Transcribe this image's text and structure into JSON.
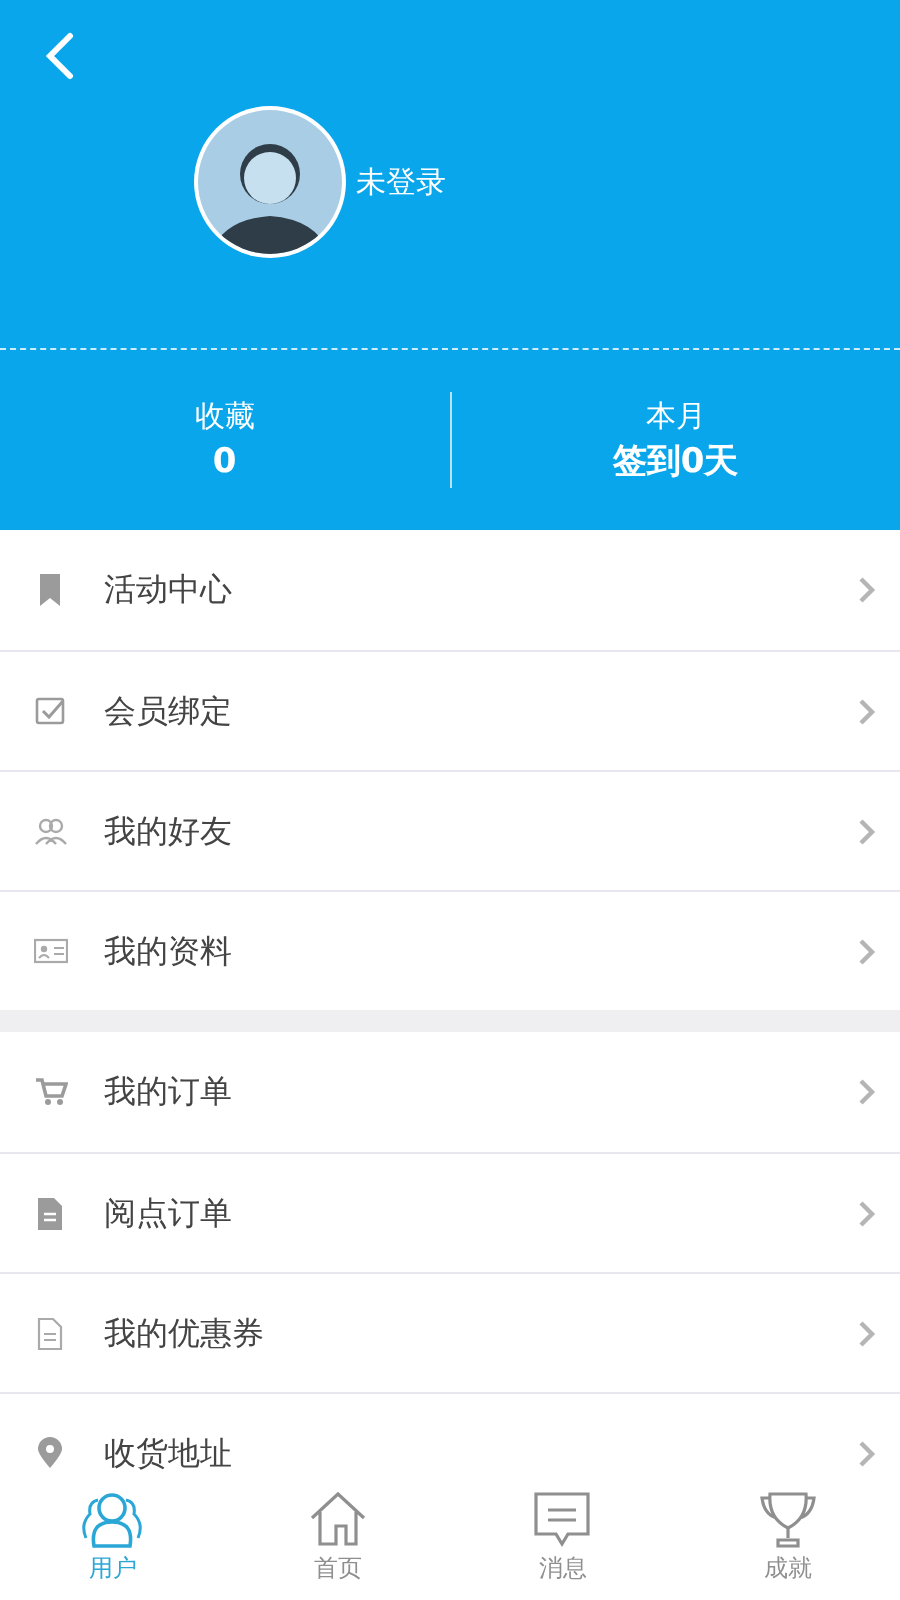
{
  "header": {
    "username": "未登录"
  },
  "stats": [
    {
      "label": "收藏",
      "value": "0"
    },
    {
      "label": "本月",
      "value": "签到0天"
    }
  ],
  "menu_groups": [
    {
      "items": [
        {
          "label": "活动中心"
        },
        {
          "label": "会员绑定"
        },
        {
          "label": "我的好友"
        },
        {
          "label": "我的资料"
        }
      ]
    },
    {
      "items": [
        {
          "label": "我的订单"
        },
        {
          "label": "阅点订单"
        },
        {
          "label": "我的优惠券"
        },
        {
          "label": "收货地址"
        }
      ]
    }
  ],
  "tabs": [
    {
      "label": "用户",
      "selected": true
    },
    {
      "label": "首页",
      "selected": false
    },
    {
      "label": "消息",
      "selected": false
    },
    {
      "label": "成就",
      "selected": false
    }
  ]
}
